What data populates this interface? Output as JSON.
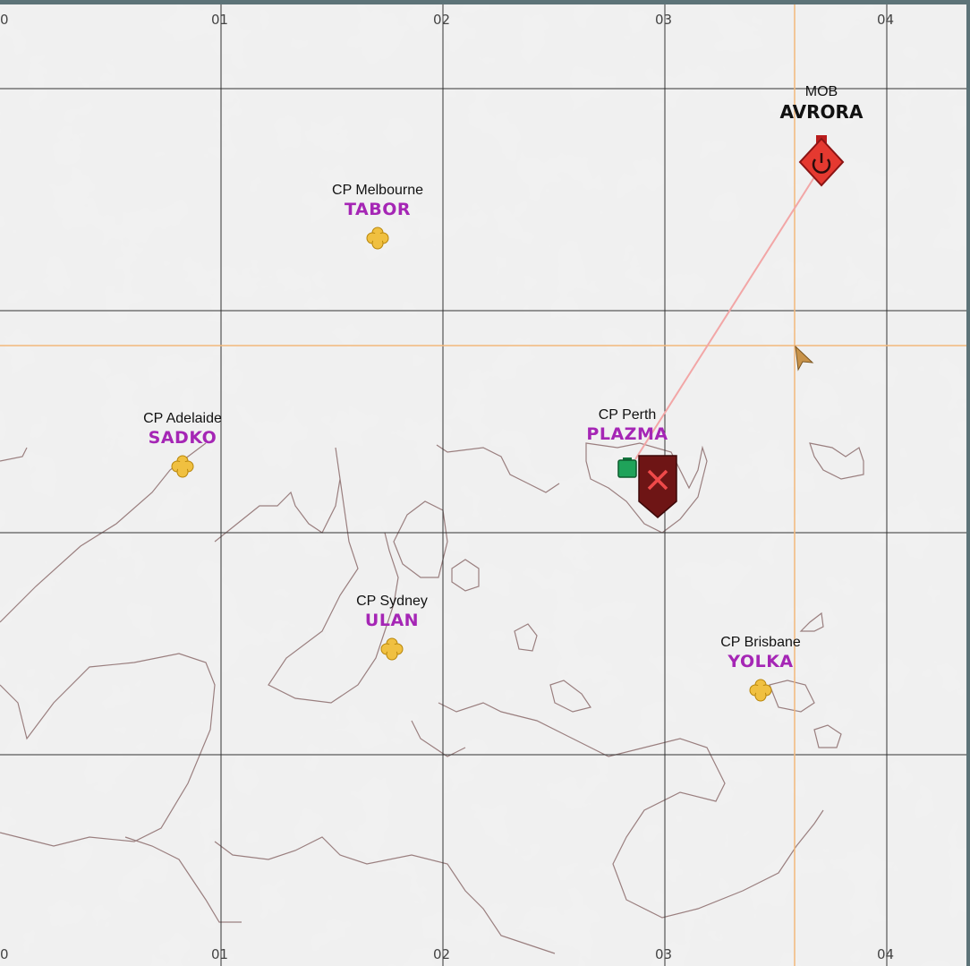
{
  "grid": {
    "top_labels": [
      "0",
      "01",
      "02",
      "03",
      "04"
    ],
    "bottom_labels": [
      "0",
      "01",
      "02",
      "03",
      "04"
    ]
  },
  "mob": {
    "name": "MOB",
    "code": "AVRORA",
    "icon": "power-diamond-icon",
    "color": "#e53930"
  },
  "capture_points": [
    {
      "name": "CP Melbourne",
      "code": "TABOR",
      "icon": "clover-icon"
    },
    {
      "name": "CP Adelaide",
      "code": "SADKO",
      "icon": "clover-icon"
    },
    {
      "name": "CP Perth",
      "code": "PLAZMA",
      "icon": "clover-icon"
    },
    {
      "name": "CP Sydney",
      "code": "ULAN",
      "icon": "clover-icon"
    },
    {
      "name": "CP Brisbane",
      "code": "YOLKA",
      "icon": "clover-icon"
    }
  ],
  "markers": {
    "enemy_shield": {
      "icon": "x-shield-icon",
      "color": "#6e1515"
    },
    "friendly_square": {
      "icon": "green-square-icon",
      "color": "#1fa35a"
    },
    "player_arrow": {
      "icon": "arrow-cursor-icon",
      "color": "#c8934a"
    }
  },
  "colors": {
    "capture_point": "#f0c040",
    "code_text": "#a526b5",
    "crosshair": "#f2b77a",
    "contour": "#9a7f7f"
  }
}
